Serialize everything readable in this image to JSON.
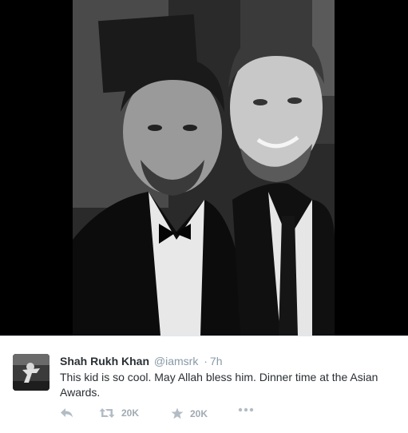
{
  "photo": {
    "alt_subject": "selfie"
  },
  "tweet": {
    "author_name": "Shah Rukh Khan",
    "author_handle": "@iamsrk",
    "separator": "·",
    "time": "7h",
    "text": "This kid is so cool. May Allah bless him. Dinner time at the Asian Awards.",
    "actions": {
      "reply_icon": "reply-icon",
      "retweet_icon": "retweet-icon",
      "retweet_count": "20K",
      "favorite_icon": "star-icon",
      "favorite_count": "20K",
      "more_icon": "more-dots-icon"
    }
  },
  "colors": {
    "name": "#292f33",
    "meta": "#8899a6",
    "action": "#b3bcc4"
  }
}
